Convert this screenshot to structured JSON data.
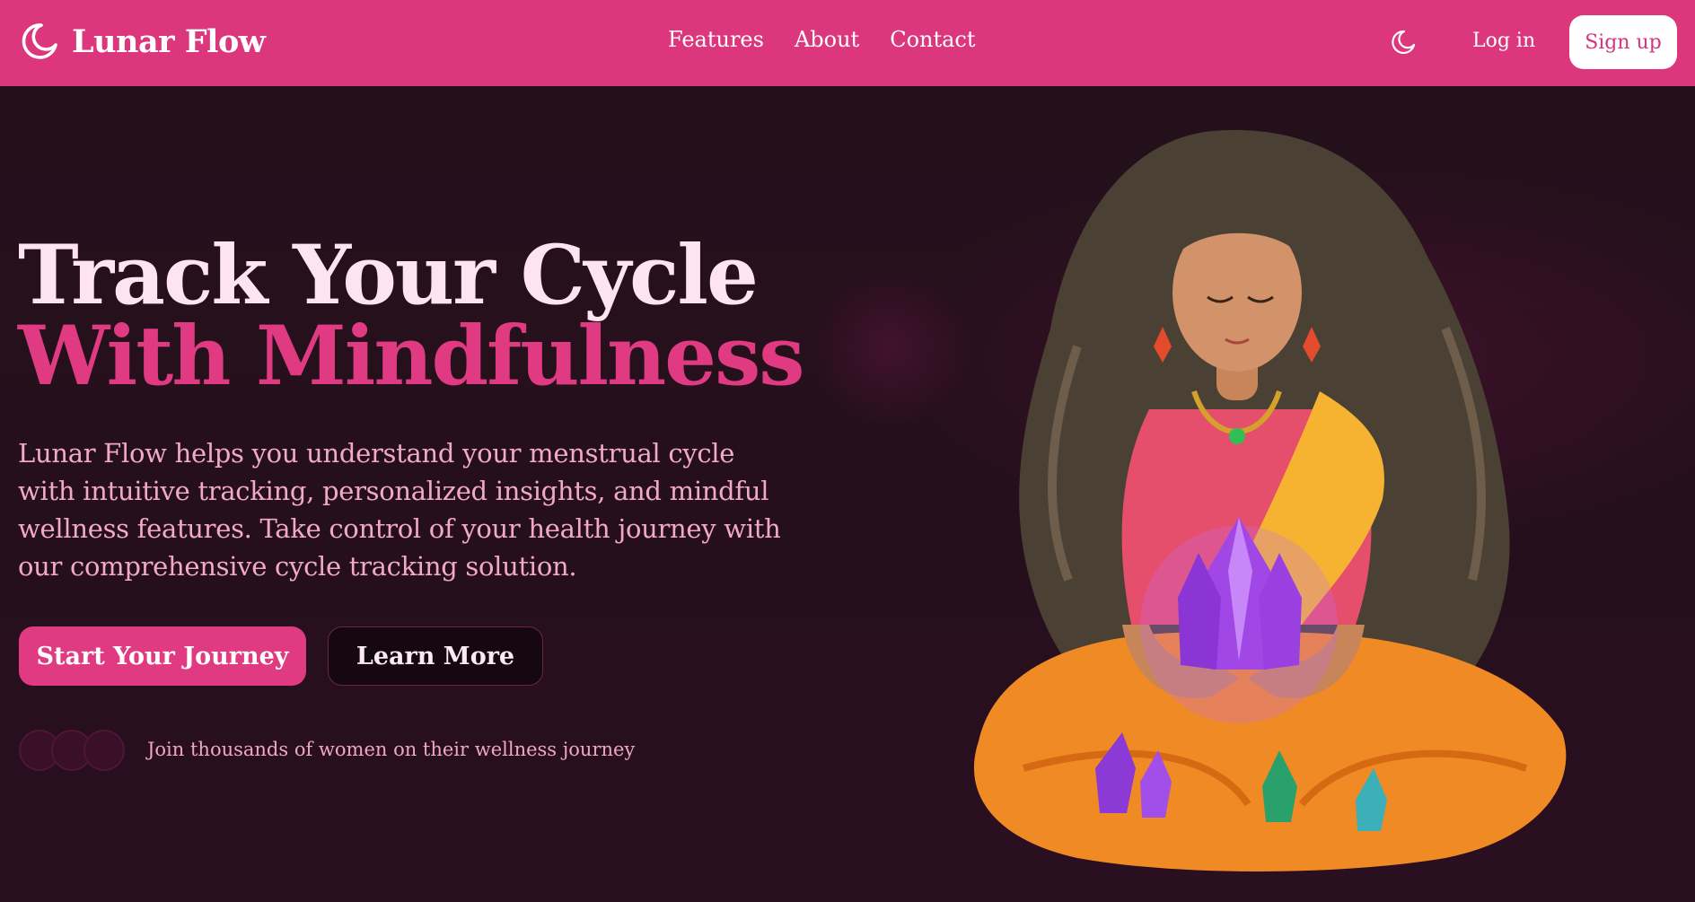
{
  "brand": {
    "name": "Lunar Flow",
    "icon": "moon-icon"
  },
  "nav": {
    "links": [
      "Features",
      "About",
      "Contact"
    ],
    "theme_icon": "moon-icon",
    "login_label": "Log in",
    "signup_label": "Sign up"
  },
  "hero": {
    "title_line1": "Track Your Cycle",
    "title_line2": "With Mindfulness",
    "description": "Lunar Flow helps you understand your menstrual cycle with intuitive tracking, personalized insights, and mindful wellness features. Take control of your health journey with our comprehensive cycle tracking solution.",
    "primary_cta": "Start Your Journey",
    "secondary_cta": "Learn More",
    "social_proof": "Join thousands of women on their wellness journey"
  },
  "colors": {
    "nav_bg": "#dc377d",
    "accent": "#e03a82",
    "page_bg": "#230f1a",
    "text_light": "#fde4ef",
    "text_pink": "#f2a8cb"
  }
}
